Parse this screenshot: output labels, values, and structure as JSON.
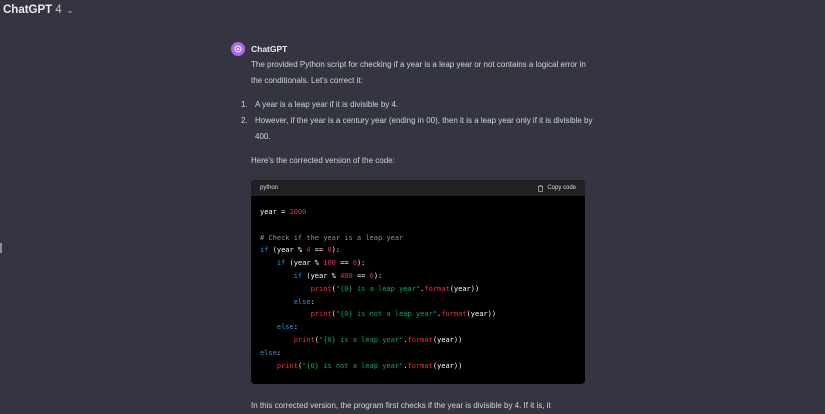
{
  "header": {
    "title": "ChatGPT",
    "version": "4"
  },
  "message": {
    "author": "ChatGPT",
    "intro": "The provided Python script for checking if a year is a leap year or not contains a logical error in the conditionals. Let's correct it:",
    "list": [
      {
        "num": "1.",
        "text": "A year is a leap year if it is divisible by 4."
      },
      {
        "num": "2.",
        "text": "However, if the year is a century year (ending in 00), then it is a leap year only if it is divisible by 400."
      }
    ],
    "lead_in": "Here's the corrected version of the code:",
    "code": {
      "language": "python",
      "copy_label": "Copy code",
      "lines": [
        "year = 2000",
        "",
        "# Check if the year is a leap year",
        "if (year % 4 == 0):",
        "    if (year % 100 == 0):",
        "        if (year % 400 == 0):",
        "            print(\"{0} is a leap year\".format(year))",
        "        else:",
        "            print(\"{0} is not a leap year\".format(year))",
        "    else:",
        "        print(\"{0} is a leap year\".format(year))",
        "else:",
        "    print(\"{0} is not a leap year\".format(year))"
      ]
    },
    "outro": "In this corrected version, the program first checks if the year is divisible by 4. If it is, it"
  },
  "colors": {
    "background": "#343541",
    "avatar": "#ab68ff",
    "code_bg": "#000000",
    "keyword": "#2e95d3",
    "number": "#df3079",
    "string": "#00a67d"
  },
  "icons": {
    "avatar": "openai-logo-icon",
    "copy": "clipboard-icon",
    "dropdown": "chevron-down-icon"
  }
}
